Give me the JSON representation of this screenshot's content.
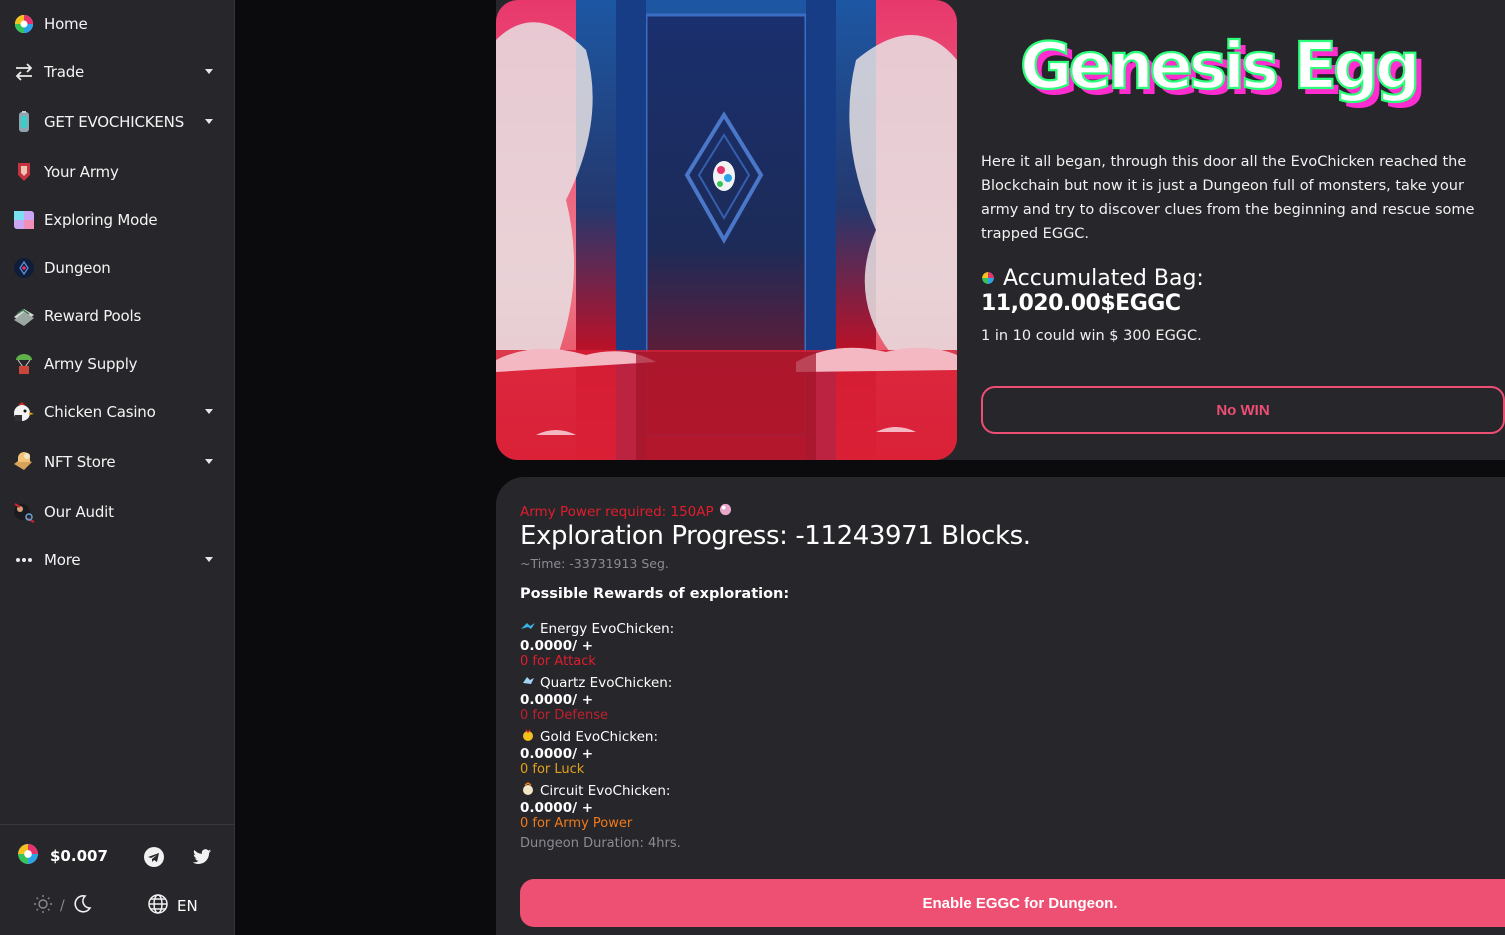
{
  "sidebar": {
    "items": [
      {
        "label": "Home",
        "icon": "egg-logo-icon",
        "has_caret": false
      },
      {
        "label": "Trade",
        "icon": "swap-arrows-icon",
        "has_caret": true
      },
      {
        "label": "GET EVOCHICKENS",
        "icon": "capsule-icon",
        "has_caret": true
      },
      {
        "label": "Your Army",
        "icon": "shield-badge-icon",
        "has_caret": false
      },
      {
        "label": "Exploring Mode",
        "icon": "cube-icon",
        "has_caret": false
      },
      {
        "label": "Dungeon",
        "icon": "portal-icon",
        "has_caret": false
      },
      {
        "label": "Reward Pools",
        "icon": "money-stack-icon",
        "has_caret": false
      },
      {
        "label": "Army Supply",
        "icon": "supply-drop-icon",
        "has_caret": false
      },
      {
        "label": "Chicken Casino",
        "icon": "casino-chicken-icon",
        "has_caret": true
      },
      {
        "label": "NFT Store",
        "icon": "store-icon",
        "has_caret": true
      },
      {
        "label": "Our Audit",
        "icon": "audit-icon",
        "has_caret": false
      },
      {
        "label": "More",
        "icon": "more-dots-icon",
        "has_caret": true
      }
    ],
    "footer": {
      "price": "$0.007",
      "separator": "/",
      "language": "EN"
    }
  },
  "hero": {
    "logo_text": "Genesis Egg",
    "description": "Here it all began, through this door all the EvoChicken reached the Blockchain but now it is just a Dungeon full of monsters, take your army and try to discover clues from the beginning and rescue some trapped EGGC.",
    "bag_title": "Accumulated Bag:",
    "bag_value": "11,020.00$EGGC",
    "chance": "1 in 10 could win $ 300 EGGC.",
    "result_button": "No WIN"
  },
  "exploration": {
    "requirement": "Army Power required: 150AP",
    "progress": "Exploration Progress: -11243971 Blocks.",
    "time": "~Time: -33731913 Seg.",
    "possible_title": "Possible Rewards of exploration:",
    "rewards": [
      {
        "name": "Energy EvoChicken:",
        "value": "0.0000/ +",
        "for": "0 for Attack",
        "color": "#e11d2d",
        "icon": "energy-chicken-icon"
      },
      {
        "name": "Quartz EvoChicken:",
        "value": "0.0000/ +",
        "for": "0 for Defense",
        "color": "#c0202c",
        "icon": "quartz-chicken-icon"
      },
      {
        "name": "Gold EvoChicken:",
        "value": "0.0000/ +",
        "for": "0 for Luck",
        "color": "#e0a21a",
        "icon": "gold-chicken-icon"
      },
      {
        "name": "Circuit EvoChicken:",
        "value": "0.0000/ +",
        "for": "0 for Army Power",
        "color": "#f07a1a",
        "icon": "circuit-chicken-icon"
      }
    ],
    "duration": "Dungeon Duration: 4hrs.",
    "enable_button": "Enable EGGC for Dungeon."
  },
  "colors": {
    "accent": "#ee5073",
    "sidebar_bg": "#27262b",
    "page_bg": "#0b0b0e",
    "danger": "#e11d2d"
  }
}
